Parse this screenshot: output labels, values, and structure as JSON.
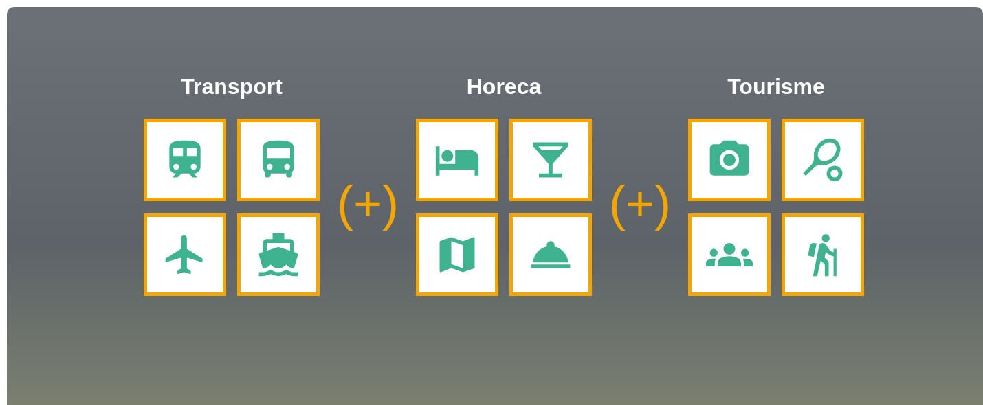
{
  "groups": [
    {
      "title": "Transport",
      "joiner": "(+)"
    },
    {
      "title": "Horeca",
      "joiner": "(+)"
    },
    {
      "title": "Tourisme"
    }
  ]
}
